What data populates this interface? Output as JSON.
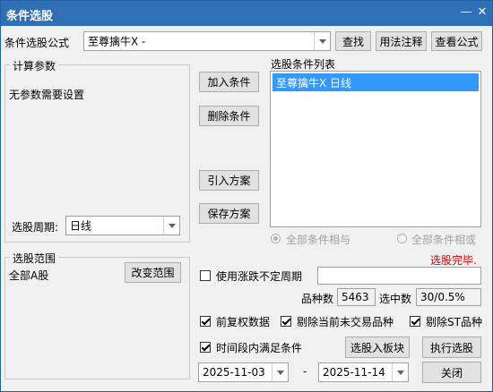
{
  "window": {
    "title": "条件选股"
  },
  "formula": {
    "label": "条件选股公式",
    "value": "至尊擒牛X  -",
    "find_btn": "查找",
    "usage_btn": "用法注释",
    "view_btn": "查看公式"
  },
  "params": {
    "group_title": "计算参数",
    "no_params_text": "无参数需要设置",
    "period_label": "选股周期:",
    "period_value": "日线"
  },
  "actions": {
    "add_condition": "加入条件",
    "delete_condition": "删除条件",
    "import_plan": "引入方案",
    "save_plan": "保存方案"
  },
  "conditions": {
    "list_title": "选股条件列表",
    "items": [
      "至尊擒牛X  日线"
    ]
  },
  "logic": {
    "and_label": "全部条件相与",
    "or_label": "全部条件相或"
  },
  "status": {
    "text": "选股完毕.",
    "color": "#e00000"
  },
  "scope": {
    "group_title": "选股范围",
    "value": "全部A股",
    "change_btn": "改变范围"
  },
  "period_option": {
    "label": "使用涨跌不定周期",
    "checked": false
  },
  "stats": {
    "count_label": "品种数",
    "count_value": "5463",
    "selected_label": "选中数",
    "selected_value": "30/0.5%"
  },
  "options": {
    "adjusted": "前复权数据",
    "exclude_nontrading": "剔除当前未交易品种",
    "exclude_st": "剔除ST品种",
    "time_range": "时间段内满足条件"
  },
  "buttons": {
    "to_block": "选股入板块",
    "execute": "执行选股",
    "close": "关闭"
  },
  "dates": {
    "start": "2025-11-03",
    "separator": "-",
    "end": "2025-11-14"
  },
  "colors": {
    "title_bar": "#2e6fb6",
    "selection": "#3399ff"
  }
}
